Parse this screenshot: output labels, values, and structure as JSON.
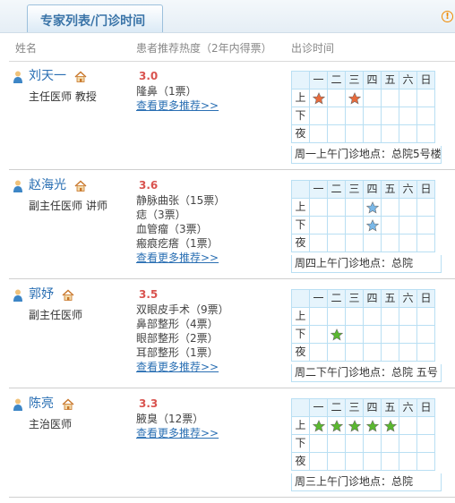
{
  "tab_title": "专家列表/门诊时间",
  "columns": {
    "name": "姓名",
    "recommend": "患者推荐热度（2年内得票）",
    "schedule": "出诊时间"
  },
  "days": [
    "一",
    "二",
    "三",
    "四",
    "五",
    "六",
    "日"
  ],
  "periods": [
    "上",
    "下",
    "夜"
  ],
  "more_link": "查看更多推荐>>",
  "colors": {
    "red_star": "#e86a3b",
    "blue_star": "#7ab8e8",
    "green_star": "#5ab82f",
    "name": "#2a6fb3",
    "score": "#d9534f"
  },
  "doctors": [
    {
      "name": "刘天一",
      "title": "主任医师 教授",
      "score": "3.0",
      "recommendations": [
        "隆鼻（1票）"
      ],
      "schedule_stars": {
        "上": [
          1,
          3
        ]
      },
      "star_color": "red",
      "location": "周一上午门诊地点：总院5号楼"
    },
    {
      "name": "赵海光",
      "title": "副主任医师 讲师",
      "score": "3.6",
      "recommendations": [
        "静脉曲张（15票）",
        "痣（3票）",
        "血管瘤（3票）",
        "瘢痕疙瘩（1票）"
      ],
      "schedule_stars": {
        "上": [
          4
        ],
        "下": [
          4
        ]
      },
      "star_color": "blue",
      "location": "周四上午门诊地点：总院"
    },
    {
      "name": "郭妤",
      "title": "副主任医师",
      "score": "3.5",
      "recommendations": [
        "双眼皮手术（9票）",
        "鼻部整形（4票）",
        "眼部整形（2票）",
        "耳部整形（1票）"
      ],
      "schedule_stars": {
        "下": [
          2
        ]
      },
      "star_color": "green",
      "location": "周二下午门诊地点：总院 五号"
    },
    {
      "name": "陈亮",
      "title": "主治医师",
      "score": "3.3",
      "recommendations": [
        "腋臭（12票）"
      ],
      "schedule_stars": {
        "上": [
          1,
          2,
          3,
          4,
          5
        ]
      },
      "star_color": "green",
      "location": "周三上午门诊地点：总院"
    }
  ]
}
